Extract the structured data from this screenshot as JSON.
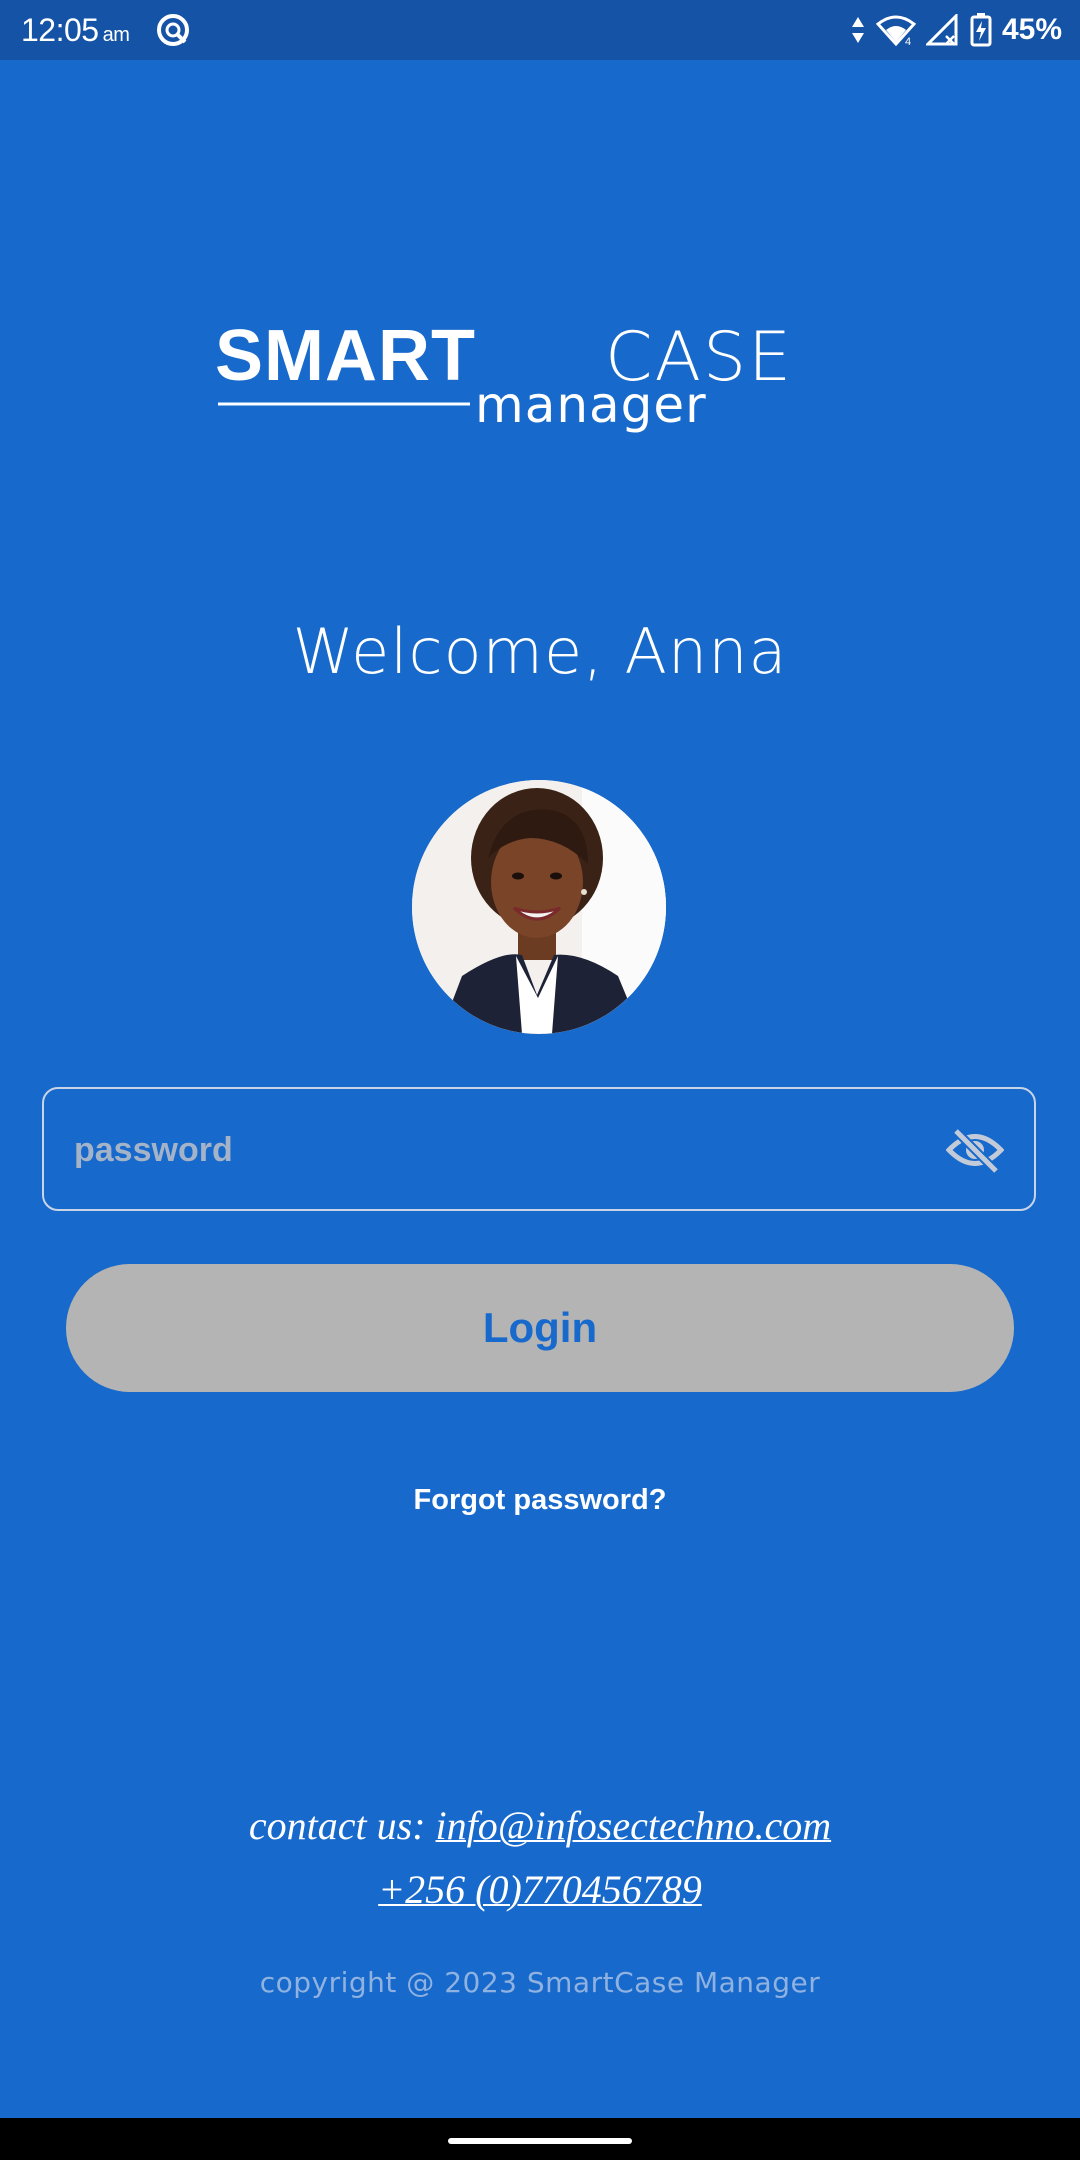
{
  "status_bar": {
    "time": "12:05",
    "ampm": "am",
    "battery_percent": "45%"
  },
  "logo": {
    "word1": "SMART",
    "word2": "CASE",
    "word3": "manager"
  },
  "welcome_text": "Welcome, Anna",
  "avatar": {
    "icon": "user-avatar-photo"
  },
  "password_field": {
    "placeholder": "password",
    "value": "",
    "toggle_icon": "eye-off-icon"
  },
  "login_button": {
    "label": "Login"
  },
  "forgot_password": "Forgot password?",
  "contact": {
    "prefix": "contact us: ",
    "email": "info@infosectechno.com",
    "phone": "+256 (0)770456789"
  },
  "copyright": "copyright @ 2023 SmartCase Manager",
  "colors": {
    "background": "#1769cc",
    "status_bar": "#1553a6",
    "button_disabled": "#b4b4b4"
  }
}
